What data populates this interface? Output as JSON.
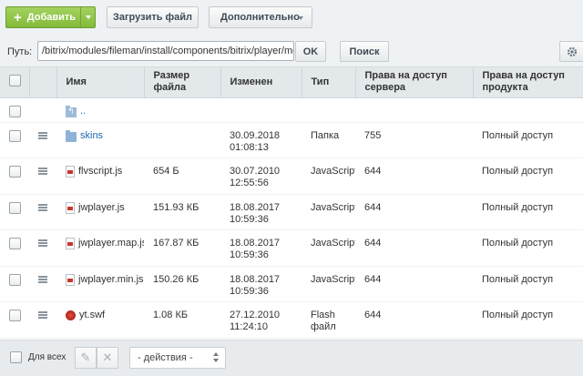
{
  "toolbar": {
    "add_label": "Добавить",
    "upload_label": "Загрузить файл",
    "more_label": "Дополнительно"
  },
  "pathbar": {
    "label": "Путь:",
    "path_value": "/bitrix/modules/fileman/install/components/bitrix/player/mediapl",
    "ok_label": "OK",
    "search_label": "Поиск"
  },
  "table": {
    "columns": {
      "name": "Имя",
      "size_l1": "Размер",
      "size_l2": "файла",
      "modified": "Изменен",
      "type": "Тип",
      "perm_server_l1": "Права на доступ",
      "perm_server_l2": "сервера",
      "perm_product_l1": "Права на доступ",
      "perm_product_l2": "продукта"
    },
    "updir": "..",
    "rows": [
      {
        "name": "skins",
        "size": "",
        "date": "30.09.2018",
        "time": "01:08:13",
        "type_l1": "Папка",
        "type_l2": "",
        "perm": "755",
        "access": "Полный доступ",
        "icon": "folder-icon"
      },
      {
        "name": "flvscript.js",
        "size": "654 Б",
        "date": "30.07.2010",
        "time": "12:55:56",
        "type_l1": "JavaScript",
        "type_l2": "",
        "perm": "644",
        "access": "Полный доступ",
        "icon": "js-file-icon"
      },
      {
        "name": "jwplayer.js",
        "size": "151.93 КБ",
        "date": "18.08.2017",
        "time": "10:59:36",
        "type_l1": "JavaScript",
        "type_l2": "",
        "perm": "644",
        "access": "Полный доступ",
        "icon": "js-file-icon"
      },
      {
        "name": "jwplayer.map.js",
        "size": "167.87 КБ",
        "date": "18.08.2017",
        "time": "10:59:36",
        "type_l1": "JavaScript",
        "type_l2": "",
        "perm": "644",
        "access": "Полный доступ",
        "icon": "js-file-icon"
      },
      {
        "name": "jwplayer.min.js",
        "size": "150.26 КБ",
        "date": "18.08.2017",
        "time": "10:59:36",
        "type_l1": "JavaScript",
        "type_l2": "",
        "perm": "644",
        "access": "Полный доступ",
        "icon": "js-file-icon"
      },
      {
        "name": "yt.swf",
        "size": "1.08 КБ",
        "date": "27.12.2010",
        "time": "11:24:10",
        "type_l1": "Flash",
        "type_l2": "файл",
        "perm": "644",
        "access": "Полный доступ",
        "icon": "swf-file-icon"
      }
    ]
  },
  "footer": {
    "select_all_label": "Для всех",
    "actions_value": "- действия -"
  },
  "colors": {
    "accent_green": "#84ba3b",
    "link_blue": "#2067b0",
    "header_bg": "#e3e8eb",
    "page_bg": "#eef2f4"
  }
}
